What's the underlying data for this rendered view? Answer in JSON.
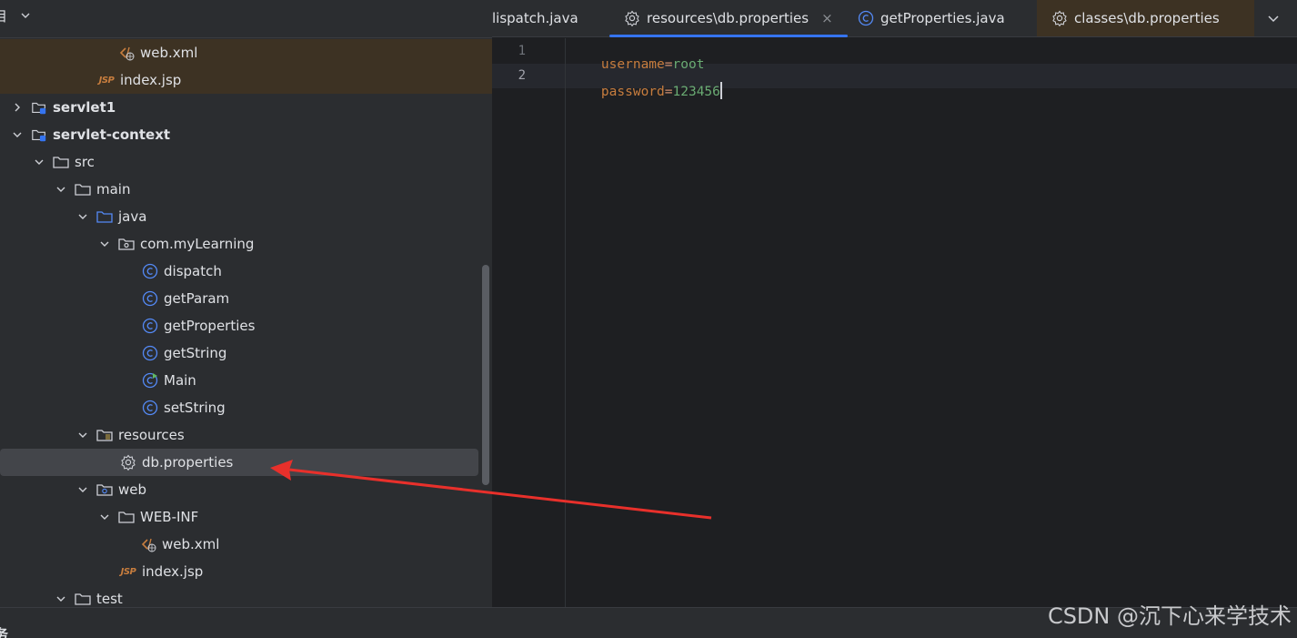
{
  "project_panel": {
    "title": "目",
    "tree": [
      {
        "label": "web.xml",
        "icon": "xml-file-icon"
      },
      {
        "label": "index.jsp",
        "icon": "jsp-file-icon"
      },
      {
        "label": "servlet1",
        "icon": "module-folder-icon"
      },
      {
        "label": "servlet-context",
        "icon": "module-folder-icon"
      },
      {
        "label": "src",
        "icon": "folder-icon"
      },
      {
        "label": "main",
        "icon": "folder-icon"
      },
      {
        "label": "java",
        "icon": "source-folder-icon"
      },
      {
        "label": "com.myLearning",
        "icon": "package-icon"
      },
      {
        "label": "dispatch",
        "icon": "class-icon"
      },
      {
        "label": "getParam",
        "icon": "class-icon"
      },
      {
        "label": "getProperties",
        "icon": "class-icon"
      },
      {
        "label": "getString",
        "icon": "class-icon"
      },
      {
        "label": "Main",
        "icon": "runnable-class-icon"
      },
      {
        "label": "setString",
        "icon": "class-icon"
      },
      {
        "label": "resources",
        "icon": "resources-folder-icon"
      },
      {
        "label": "db.properties",
        "icon": "gear-icon"
      },
      {
        "label": "web",
        "icon": "web-folder-icon"
      },
      {
        "label": "WEB-INF",
        "icon": "folder-icon"
      },
      {
        "label": "web.xml",
        "icon": "xml-file-icon"
      },
      {
        "label": "index.jsp",
        "icon": "jsp-file-icon"
      },
      {
        "label": "test",
        "icon": "folder-icon"
      }
    ],
    "jsp_badge": "JSP"
  },
  "tabs": [
    {
      "label": "lispatch.java",
      "icon": "class-icon"
    },
    {
      "label": "resources\\db.properties",
      "icon": "gear-icon",
      "close": "×"
    },
    {
      "label": "getProperties.java",
      "icon": "class-icon"
    },
    {
      "label": "classes\\db.properties",
      "icon": "gear-icon"
    }
  ],
  "editor": {
    "line_numbers": [
      "1",
      "2"
    ],
    "lines": [
      {
        "key": "username",
        "eq": "=",
        "value": "root"
      },
      {
        "key": "password",
        "eq": "=",
        "value": "123456"
      }
    ]
  },
  "bottom": {
    "label": "务"
  },
  "watermark": "CSDN @沉下心来学技术",
  "colors": {
    "accent": "#3574f0",
    "class_icon": "#548af7",
    "annotation_arrow": "#e8302b",
    "property_key": "#c77d3e",
    "property_value": "#6aab73"
  }
}
